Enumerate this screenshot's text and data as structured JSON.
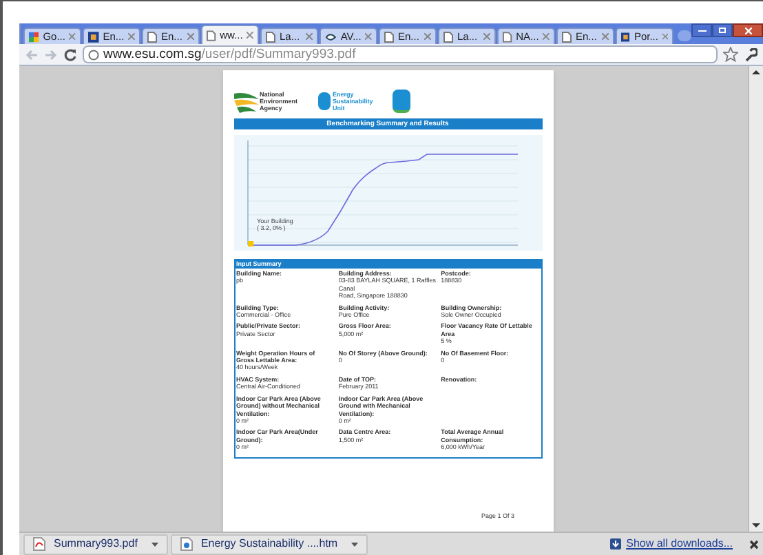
{
  "tabs": [
    {
      "label": "Go...",
      "kind": "google",
      "selected": false
    },
    {
      "label": "En...",
      "kind": "app",
      "selected": false
    },
    {
      "label": "En...",
      "kind": "page",
      "selected": false
    },
    {
      "label": "ww...",
      "kind": "page",
      "selected": true
    },
    {
      "label": "La...",
      "kind": "page",
      "selected": false
    },
    {
      "label": "AV...",
      "kind": "link",
      "selected": false
    },
    {
      "label": "En...",
      "kind": "page",
      "selected": false
    },
    {
      "label": "La...",
      "kind": "page",
      "selected": false
    },
    {
      "label": "NA...",
      "kind": "page",
      "selected": false
    },
    {
      "label": "En...",
      "kind": "page",
      "selected": false
    },
    {
      "label": "Por...",
      "kind": "app",
      "selected": false
    }
  ],
  "address_bar": {
    "host": "www.esu.com.sg",
    "path": "/user/pdf/Summary993.pdf"
  },
  "pdf": {
    "org_name": "National Environment Agency",
    "unit_name": [
      "Energy",
      "Sustainability",
      "Unit"
    ],
    "title": "Benchmarking Summary and Results",
    "chart_label": [
      "Your Building",
      "( 3.2, 0% )"
    ],
    "summary_title": "Input Summary",
    "rows": [
      [
        {
          "label": "Building Name:",
          "value": [
            "pb"
          ]
        },
        {
          "label": "Building Address:",
          "value": [
            "03-83 BAYLAH SQUARE, 1 Raffles Canal",
            "Road, Singapore 188830"
          ]
        },
        {
          "label": "Postcode:",
          "value": [
            "188830"
          ]
        }
      ],
      [
        {
          "label": "Building Type:",
          "value": [
            "Commercial - Office"
          ]
        },
        {
          "label": "Building Activity:",
          "value": [
            "Pure Office"
          ]
        },
        {
          "label": "Building Ownership:",
          "value": [
            "Sole Owner Occupied"
          ]
        }
      ],
      [
        {
          "label": "Public/Private Sector:",
          "value": [
            "Private Sector"
          ]
        },
        {
          "label": "Gross Floor Area:",
          "value": [
            "5,000 m²"
          ]
        },
        {
          "label": "Floor Vacancy Rate Of Lettable Area",
          "value": [
            "5 %"
          ]
        }
      ],
      [
        {
          "label": "Weight Operation Hours of Gross Lettable Area:",
          "value": [
            "40 hours/Week"
          ]
        },
        {
          "label": "No Of Storey (Above Ground):",
          "value": [
            "0"
          ]
        },
        {
          "label": "No Of Basement Floor:",
          "value": [
            "0"
          ]
        }
      ],
      [
        {
          "label": "HVAC System:",
          "value": [
            "Central Air-Conditioned"
          ]
        },
        {
          "label": "Date of TOP:",
          "value": [
            "February 2011"
          ]
        },
        {
          "label": "Renovation:"
        }
      ],
      [
        {
          "label": "Indoor Car Park Area (Above Ground) without Mechanical Ventilation:",
          "value": [
            "0 m²"
          ]
        },
        {
          "label": "Indoor Car Park Area (Above Ground with Mechanical Ventilation):",
          "value": [
            "0 m²"
          ]
        }
      ],
      [
        {
          "label": "Indoor Car Park Area(Under Ground):",
          "value": [
            "0 m²"
          ]
        },
        {
          "label": "Data Centre Area:",
          "value": [
            "1,500 m²"
          ]
        },
        {
          "label": "Total Average Annual Consumption:",
          "value": [
            "6,000 kWh/Year"
          ]
        }
      ]
    ],
    "page_number": "Page 1 Of 3"
  },
  "downloads": [
    {
      "name": "Summary993.pdf",
      "kind": "pdf"
    },
    {
      "name": "Energy Sustainability ....htm",
      "kind": "web"
    }
  ],
  "show_all": "Show all downloads..."
}
